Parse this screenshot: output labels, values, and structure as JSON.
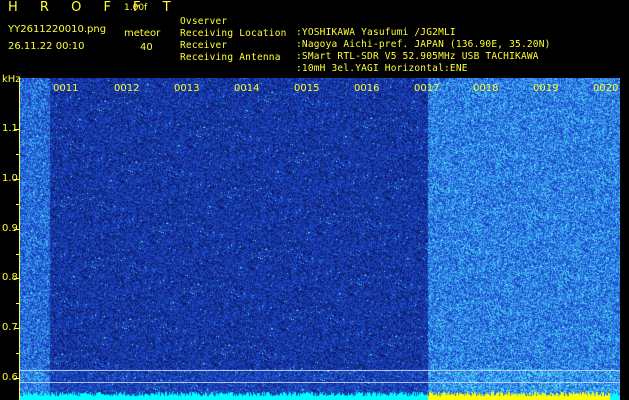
{
  "header": {
    "logo": "H R O F F T",
    "version": "1.00f",
    "filename": "YY2611220010.png",
    "timestamp": "26.11.22 00:10",
    "meteor_label": "meteor",
    "meteor_count": "40"
  },
  "info": [
    {
      "key": "Ovserver",
      "value": ":YOSHIKAWA Yasufumi /JG2MLI"
    },
    {
      "key": "Receiving Location",
      "value": ":Nagoya Aichi-pref. JAPAN (136.90E, 35.20N)"
    },
    {
      "key": "Receiver",
      "value": ":SMart RTL-SDR V5 52.905MHz USB TACHIKAWA"
    },
    {
      "key": "Receiving Antenna",
      "value": ":10mH 3el.YAGI Horizontal:ENE"
    }
  ],
  "axis": {
    "unit": "kHz",
    "labels": [
      "1.1",
      "1.0",
      "0.9",
      "0.8",
      "0.7",
      "0.6"
    ]
  },
  "time_ticks": [
    "0011",
    "0012",
    "0013",
    "0014",
    "0015",
    "0016",
    "0017",
    "0018",
    "0019",
    "0020"
  ],
  "colors": {
    "text": "#ffff33",
    "background": "#000000",
    "spectrum_low": "#1020a0",
    "spectrum_high": "#00ffff"
  }
}
